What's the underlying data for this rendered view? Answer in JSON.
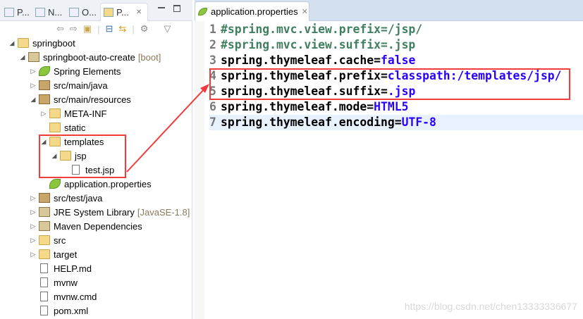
{
  "left_panel": {
    "tabs": [
      {
        "label": "P...",
        "icon": "package-explorer-icon"
      },
      {
        "label": "N...",
        "icon": "navigator-icon"
      },
      {
        "label": "O...",
        "icon": "outline-icon"
      },
      {
        "label": "P...",
        "icon": "project-explorer-icon",
        "active": true
      }
    ],
    "tree": [
      {
        "label": "springboot",
        "level": 0,
        "twisty": "expanded",
        "icon": "working-set"
      },
      {
        "label": "springboot-auto-create",
        "deco": "[boot]",
        "level": 1,
        "twisty": "expanded",
        "icon": "maven-project"
      },
      {
        "label": "Spring Elements",
        "level": 2,
        "twisty": "collapsed",
        "icon": "leaf"
      },
      {
        "label": "src/main/java",
        "level": 2,
        "twisty": "collapsed",
        "icon": "pkg"
      },
      {
        "label": "src/main/resources",
        "level": 2,
        "twisty": "expanded",
        "icon": "pkg"
      },
      {
        "label": "META-INF",
        "level": 3,
        "twisty": "collapsed",
        "icon": "folder"
      },
      {
        "label": "static",
        "level": 3,
        "twisty": "",
        "icon": "folder"
      },
      {
        "label": "templates",
        "level": 3,
        "twisty": "expanded",
        "icon": "folder"
      },
      {
        "label": "jsp",
        "level": 4,
        "twisty": "expanded",
        "icon": "folder"
      },
      {
        "label": "test.jsp",
        "level": 5,
        "twisty": "",
        "icon": "file"
      },
      {
        "label": "application.properties",
        "level": 3,
        "twisty": "",
        "icon": "leaf"
      },
      {
        "label": "src/test/java",
        "level": 2,
        "twisty": "collapsed",
        "icon": "pkg"
      },
      {
        "label": "JRE System Library",
        "deco": "[JavaSE-1.8]",
        "level": 2,
        "twisty": "collapsed",
        "icon": "lib"
      },
      {
        "label": "Maven Dependencies",
        "level": 2,
        "twisty": "collapsed",
        "icon": "lib"
      },
      {
        "label": "src",
        "level": 2,
        "twisty": "collapsed",
        "icon": "folder"
      },
      {
        "label": "target",
        "level": 2,
        "twisty": "collapsed",
        "icon": "folder"
      },
      {
        "label": "HELP.md",
        "level": 2,
        "twisty": "",
        "icon": "file"
      },
      {
        "label": "mvnw",
        "level": 2,
        "twisty": "",
        "icon": "file"
      },
      {
        "label": "mvnw.cmd",
        "level": 2,
        "twisty": "",
        "icon": "file"
      },
      {
        "label": "pom.xml",
        "level": 2,
        "twisty": "",
        "icon": "file"
      }
    ]
  },
  "editor": {
    "tab_label": "application.properties",
    "lines": [
      {
        "n": "1",
        "key": "#spring.mvc.view.prefix=/jsp/",
        "value": "",
        "comment": true
      },
      {
        "n": "2",
        "key": "#spring.mvc.view.suffix=.jsp",
        "value": "",
        "comment": true
      },
      {
        "n": "3",
        "key": "spring.thymeleaf.cache=",
        "value": "false"
      },
      {
        "n": "4",
        "key": "spring.thymeleaf.prefix=",
        "value": "classpath:/templates/jsp/"
      },
      {
        "n": "5",
        "key": "spring.thymeleaf.suffix=",
        "value": ".jsp"
      },
      {
        "n": "6",
        "key": "spring.thymeleaf.mode=",
        "value": "HTML5"
      },
      {
        "n": "7",
        "key": "spring.thymeleaf.encoding=",
        "value": "UTF-8",
        "current": true
      }
    ]
  },
  "watermark": "https://blog.csdn.net/chen13333336677",
  "colors": {
    "highlight": "#f03c3c",
    "value": "#2a00ff",
    "comment": "#3f7f5f"
  }
}
